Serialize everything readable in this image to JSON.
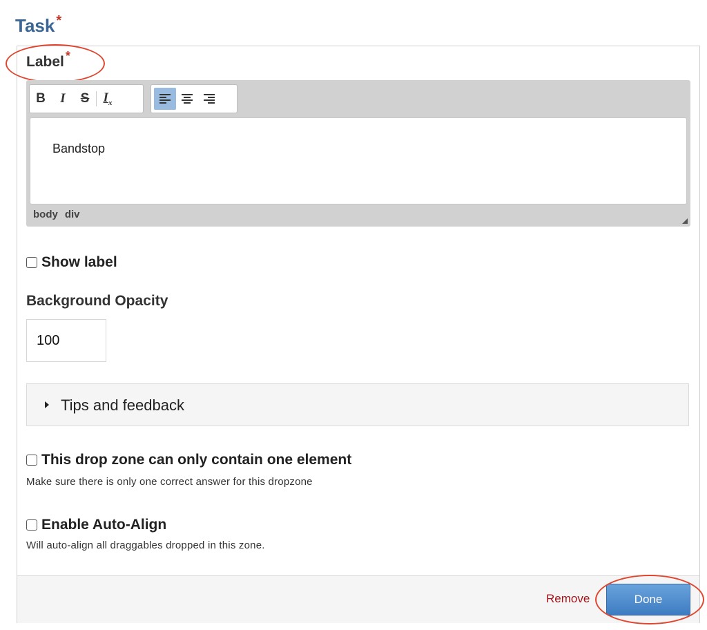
{
  "task": {
    "title": "Task",
    "required_mark": "*"
  },
  "label_field": {
    "title": "Label",
    "required_mark": "*"
  },
  "editor": {
    "toolbar_format": [
      {
        "icon": "bold-icon",
        "glyph": "B"
      },
      {
        "icon": "italic-icon",
        "glyph": "I"
      },
      {
        "icon": "strikethrough-icon",
        "glyph": "S"
      },
      {
        "icon": "remove-format-icon",
        "glyph": "Ix"
      }
    ],
    "toolbar_align": [
      {
        "icon": "align-left-icon",
        "active": true
      },
      {
        "icon": "align-center-icon",
        "active": false
      },
      {
        "icon": "align-right-icon",
        "active": false
      }
    ],
    "content": "Bandstop",
    "path": [
      "body",
      "div"
    ]
  },
  "show_label": {
    "label": "Show label",
    "checked": false
  },
  "opacity": {
    "title": "Background Opacity",
    "value": "100"
  },
  "tips": {
    "label": "Tips and feedback"
  },
  "single_element": {
    "label": "This drop zone can only contain one element",
    "help": "Make sure there is only one correct answer for this dropzone",
    "checked": false
  },
  "auto_align": {
    "label": "Enable Auto-Align",
    "help": "Will auto-align all draggables dropped in this zone.",
    "checked": false
  },
  "footer": {
    "remove_label": "Remove",
    "done_label": "Done"
  },
  "colors": {
    "title_blue": "#3b6593",
    "required_red": "#c0392b",
    "highlight_ellipse": "#e0462f",
    "remove_red": "#a3141b",
    "done_blue": "#3d7cc2",
    "active_align": "#99bbe0"
  }
}
